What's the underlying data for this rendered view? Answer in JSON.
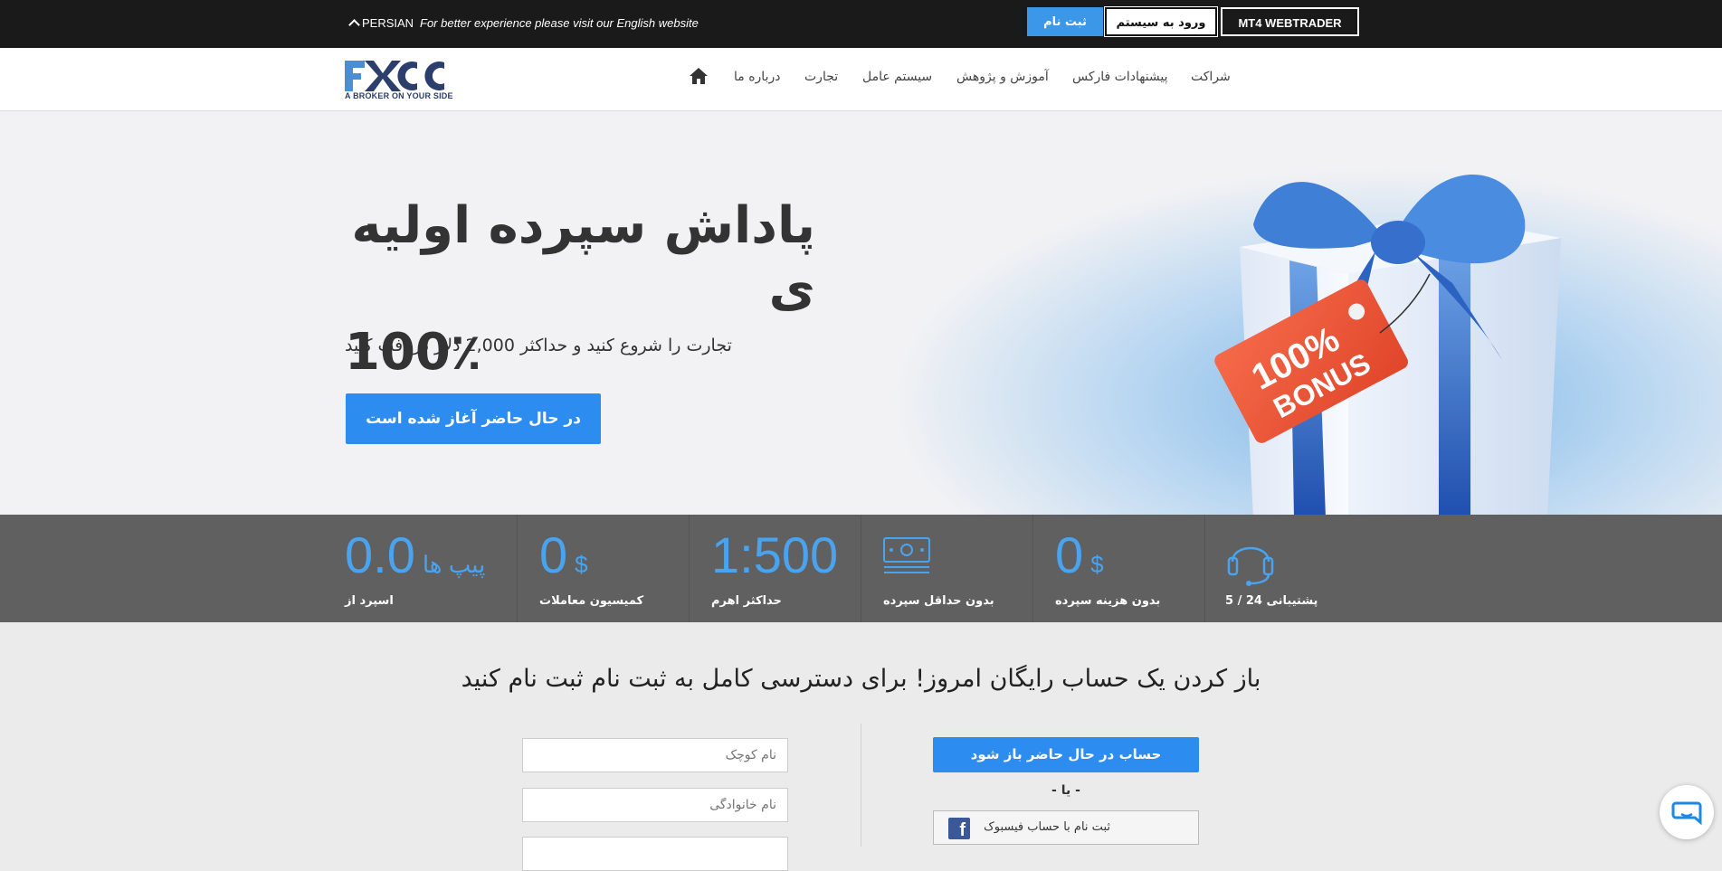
{
  "topbar": {
    "language": "PERSIAN",
    "promo": "For better experience please visit our English website",
    "register": "ثبت نام",
    "login": "ورود به سیستم",
    "webtrader": "MT4 WEBTRADER"
  },
  "logo": {
    "wordmark": "FXCC",
    "tagline": "A BROKER ON YOUR SIDE"
  },
  "nav": {
    "items": [
      "شراکت",
      "پیشنهادات فارکس",
      "آموزش و پژوهش",
      "سیستم عامل",
      "تجارت",
      "درباره ما"
    ],
    "home_icon": "home-icon"
  },
  "hero": {
    "title_line1": "پاداش سپرده اولیه ی",
    "title_line2": "100٪",
    "subtitle": "تجارت را شروع کنید و حداکثر 2,000 دلار دریافت کنید",
    "cta": "در حال حاضر آغاز شده است",
    "badge_line1": "100%",
    "badge_line2": "BONUS"
  },
  "stats": [
    {
      "value": "0.0",
      "unit": "پیپ ها",
      "label": "اسپرد از"
    },
    {
      "value": "0",
      "unit": "$",
      "label": "کمیسیون معاملات"
    },
    {
      "value": "1:500",
      "label": "حداکثر اهرم"
    },
    {
      "icon": "money-icon",
      "label": "بدون حداقل سپرده"
    },
    {
      "value": "0",
      "unit": "$",
      "label": "بدون هزینه سپرده"
    },
    {
      "icon": "headset-icon",
      "label": "پشتیبانی 24 / 5"
    }
  ],
  "signup": {
    "title": "باز کردن یک حساب رایگان امروز! برای دسترسی کامل به ثبت نام ثبت نام کنید",
    "first_name_placeholder": "نام کوچک",
    "last_name_placeholder": "نام خانوادگی",
    "open_account": "حساب در حال حاضر باز شود",
    "or": "- یا -",
    "facebook": "ثبت نام با حساب فیسبوک"
  },
  "colors": {
    "accent": "#2d8cf0",
    "topbar": "#1a1a1a",
    "stats_bg": "#606060",
    "stat_value": "#4aa3ee"
  }
}
